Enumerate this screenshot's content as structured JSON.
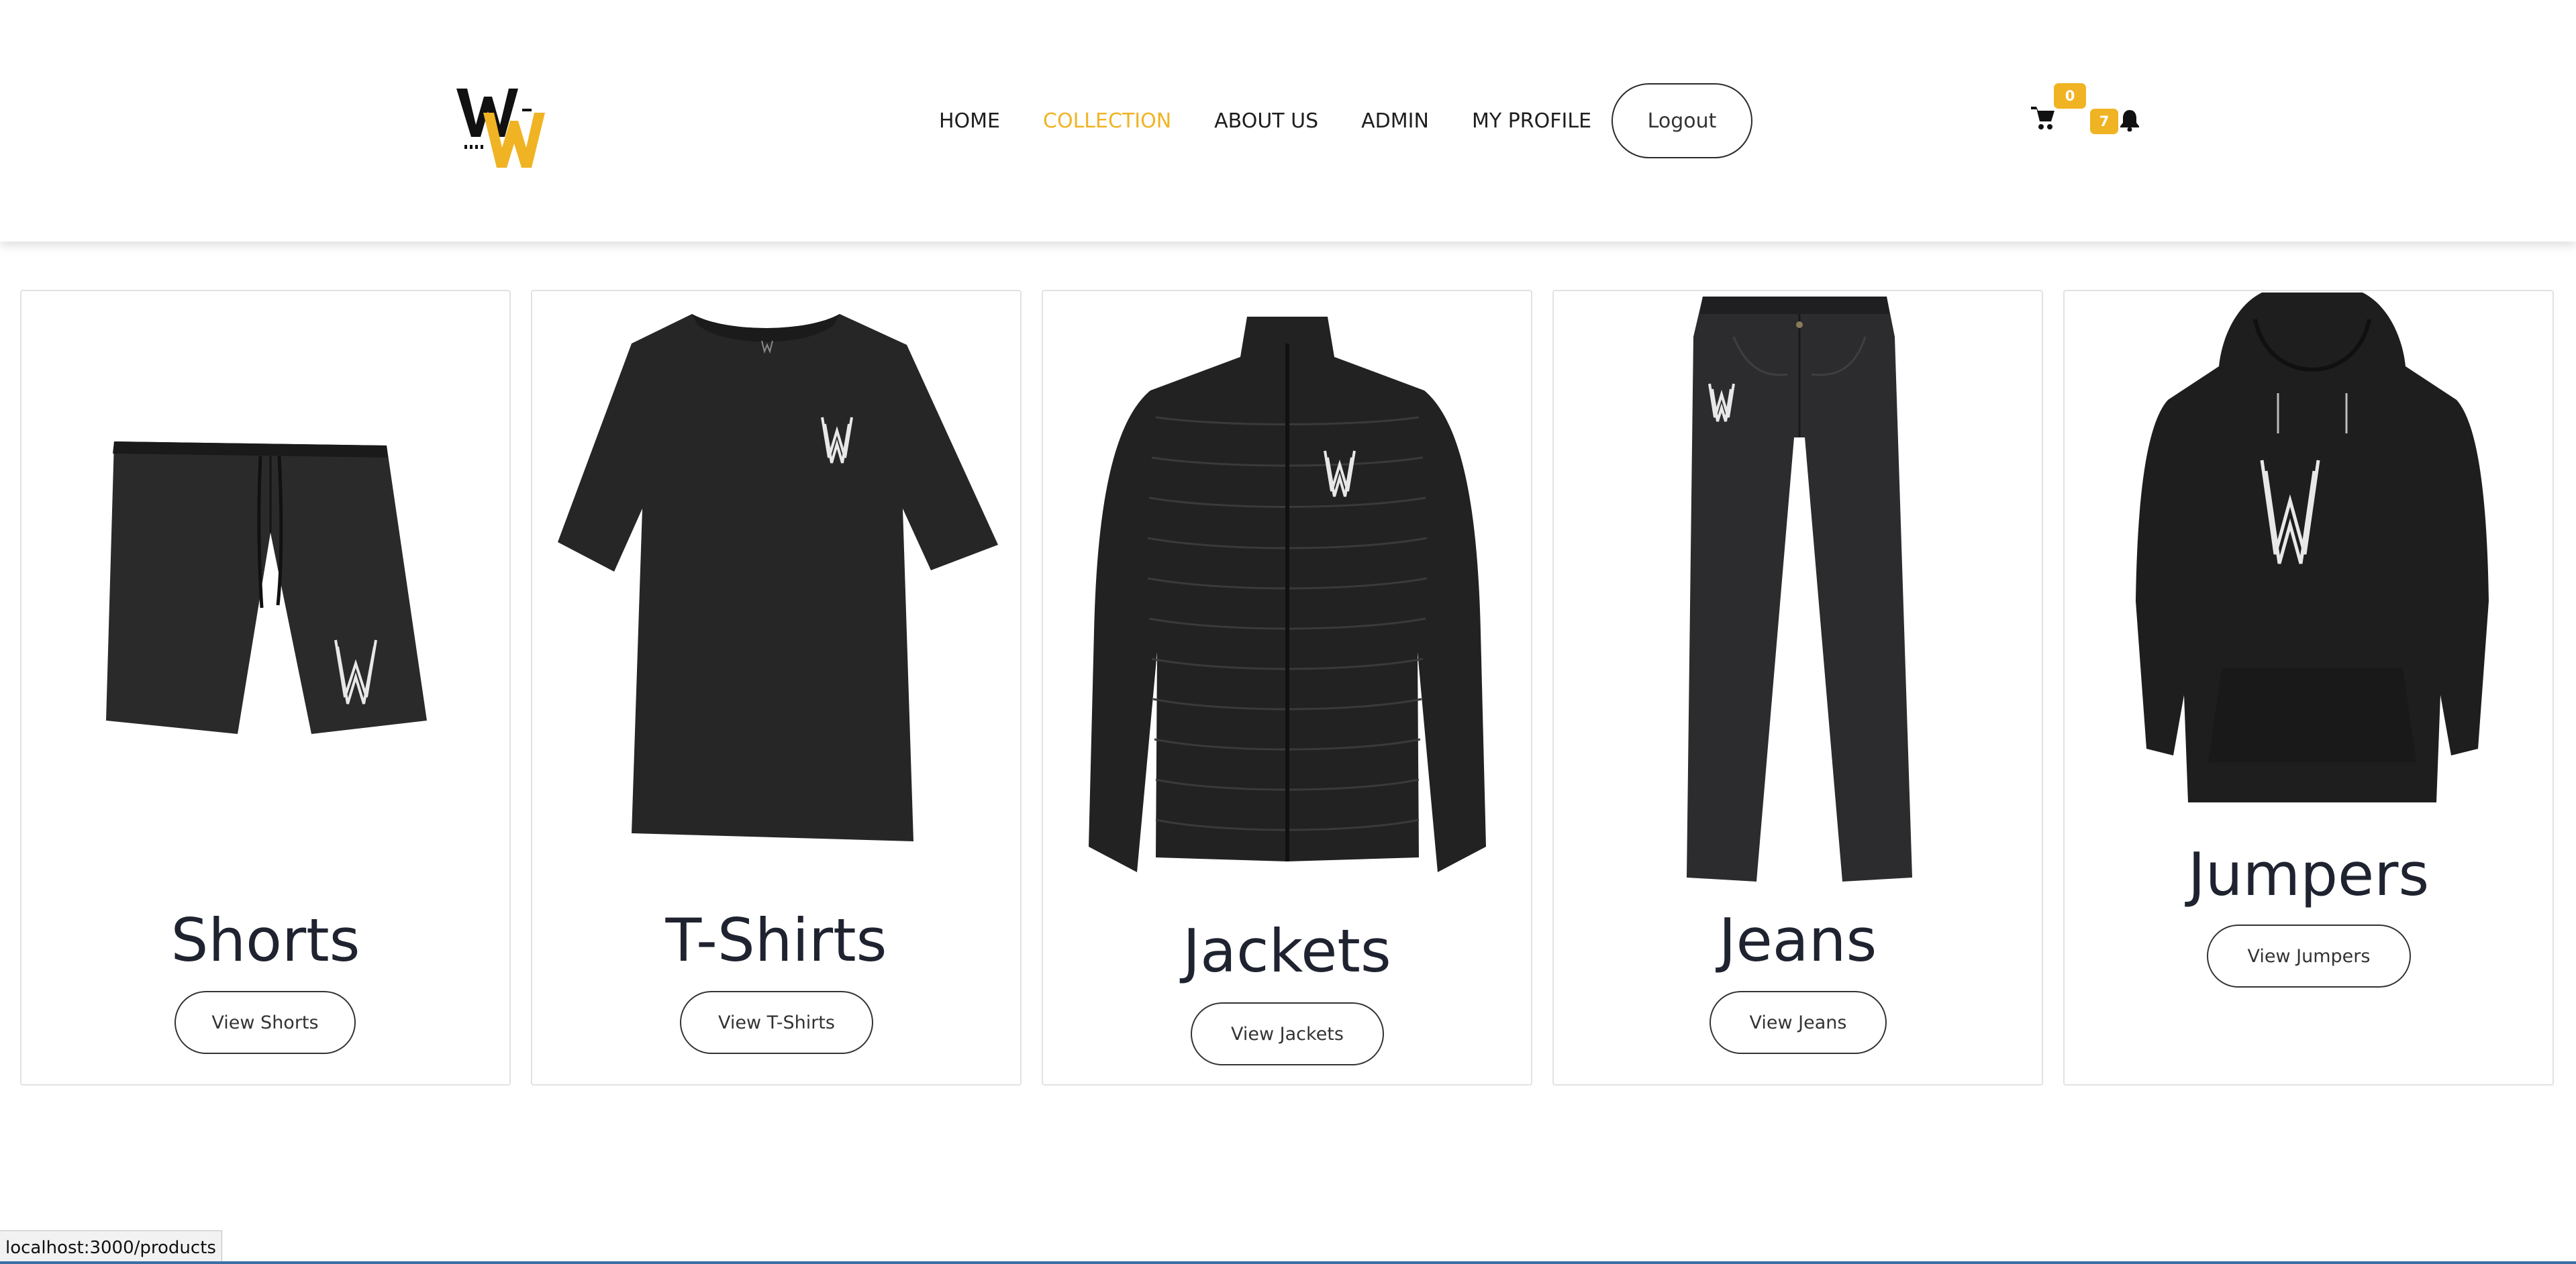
{
  "header": {
    "nav": [
      {
        "label": "HOME"
      },
      {
        "label": "COLLECTION",
        "active": true
      },
      {
        "label": "ABOUT US"
      },
      {
        "label": "ADMIN"
      },
      {
        "label": "MY PROFILE"
      }
    ],
    "logout_label": "Logout",
    "cart_count": "0",
    "notification_count": "7",
    "accent_color": "#f0b323"
  },
  "categories": [
    {
      "title": "Shorts",
      "button": "View Shorts",
      "icon": "shorts-image"
    },
    {
      "title": "T-Shirts",
      "button": "View T-Shirts",
      "icon": "tshirt-image"
    },
    {
      "title": "Jackets",
      "button": "View Jackets",
      "icon": "jacket-image"
    },
    {
      "title": "Jeans",
      "button": "View Jeans",
      "icon": "jeans-image"
    },
    {
      "title": "Jumpers",
      "button": "View Jumpers",
      "icon": "hoodie-image"
    }
  ],
  "status_bar": {
    "url": "localhost:3000/products"
  }
}
